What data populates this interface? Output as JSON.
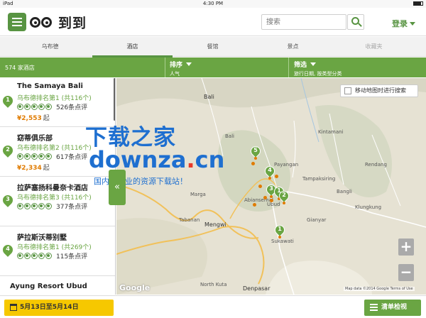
{
  "status_bar": {
    "device": "iPad",
    "time": "4:30 PM"
  },
  "header": {
    "logo_text": "到到",
    "search_placeholder": "搜索",
    "login_label": "登录"
  },
  "tabs": [
    {
      "label": "乌布德"
    },
    {
      "label": "酒店"
    },
    {
      "label": "餐馆"
    },
    {
      "label": "景点"
    },
    {
      "label": "收藏夹"
    }
  ],
  "filter_bar": {
    "count": "574 家酒店",
    "sort_title": "排序",
    "sort_sub": "人气",
    "filter_title": "筛选",
    "filter_sub": "旅行日期, 按类型分类"
  },
  "hotels": [
    {
      "num": "1",
      "name": "The Samaya Bali",
      "rank": "乌布德排名第1 (共116个)",
      "reviews": "526条点评",
      "price": "¥2,553",
      "price_unit": "起",
      "rating": 5
    },
    {
      "num": "2",
      "name": "窈蒂俱乐部",
      "rank": "乌布德排名第2 (共116个)",
      "reviews": "617条点评",
      "price": "¥2,334",
      "price_unit": "起",
      "rating": 5
    },
    {
      "num": "3",
      "name": "拉萨塞扬科曼奈卡酒店",
      "rank": "乌布德排名第3 (共116个)",
      "reviews": "377条点评",
      "price": "",
      "price_unit": "",
      "rating": 5
    },
    {
      "num": "4",
      "name": "萨拉斯沃蒂别墅",
      "rank": "乌布德排名第1 (共269个)",
      "reviews": "115条点评",
      "price": "",
      "price_unit": "",
      "rating": 5
    },
    {
      "num": "",
      "name": "Ayung Resort Ubud",
      "rank": "",
      "reviews": "",
      "price": "",
      "price_unit": "",
      "rating": 0
    }
  ],
  "map": {
    "move_search_label": "移动地图时进行搜索",
    "zoom_in": "+",
    "zoom_out": "−",
    "footer": "Map data ©2014 Google   Terms of Use",
    "google": "Google",
    "labels": {
      "bali": "Bali",
      "mengwi": "Mengwi",
      "tabanan": "Tabanan",
      "denpasar": "Denpasar",
      "kuta": "North Kuta",
      "abiansemal": "Abiansemal",
      "ubud": "Ubud",
      "payangan": "Payangan",
      "tampaksiring": "Tampaksiring",
      "klungkung": "Klungkung",
      "gianyar": "Gianyar",
      "sukawati": "Sukawati",
      "kintamani": "Kintamani",
      "rendang": "Rendang",
      "bangli": "Bangli",
      "marga": "Marga"
    },
    "pins": [
      "5",
      "4",
      "3",
      "1",
      "2",
      "1"
    ]
  },
  "watermark": {
    "line1": "下载之家",
    "line2a": "downza",
    "line2b": ".",
    "line2c": "cn",
    "line3": "国内最专业的资源下载站！"
  },
  "bottom": {
    "date_label": "5月13日至5月14日",
    "list_label": "清单检视"
  }
}
